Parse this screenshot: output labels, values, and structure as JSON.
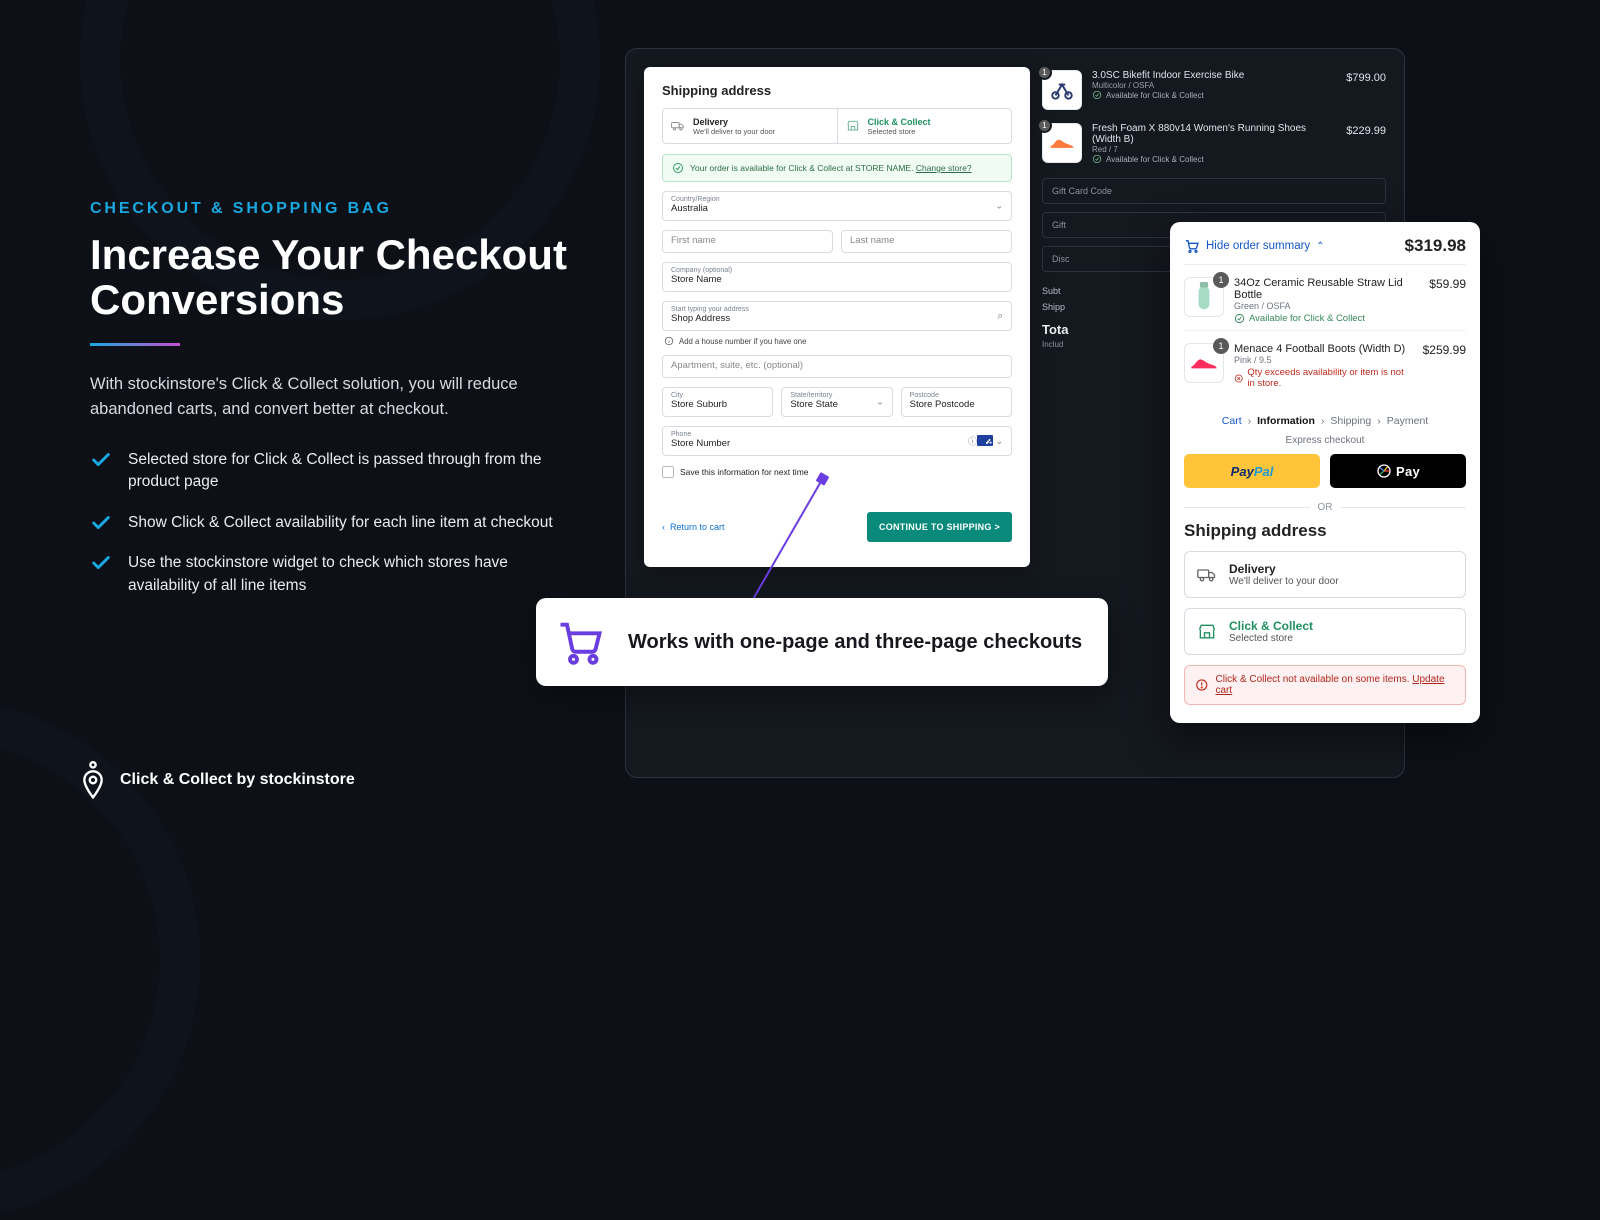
{
  "marketing": {
    "kicker": "CHECKOUT & SHOPPING BAG",
    "headline1": "Increase Your Checkout",
    "headline2": "Conversions",
    "lead": "With stockinstore's Click & Collect solution, you will reduce abandoned carts, and convert better at checkout.",
    "bullets": [
      "Selected store for Click & Collect is passed through from the product page",
      "Show Click & Collect availability for each line item at checkout",
      "Use the stockinstore widget to check which stores have availability of all line items"
    ],
    "footer": "Click & Collect by stockinstore"
  },
  "callout": "Works with one-page and three-page checkouts",
  "checkout": {
    "title": "Shipping address",
    "delivery": {
      "title": "Delivery",
      "sub": "We'll deliver to your door"
    },
    "cc": {
      "title": "Click & Collect",
      "sub": "Selected store"
    },
    "notice_a": "Your order is available for Click & Collect at STORE NAME.",
    "notice_link": "Change store?",
    "fields": {
      "country_label": "Country/Region",
      "country": "Australia",
      "first_name": "First name",
      "last_name": "Last name",
      "company_label": "Company (optional)",
      "company": "Store Name",
      "addr_label": "Start typing your address",
      "addr": "Shop Address",
      "hint": "Add a house number if you have one",
      "apt": "Apartment, suite, etc. (optional)",
      "city_label": "City",
      "city": "Store Suburb",
      "state_label": "State/territory",
      "state": "Store State",
      "post_label": "Postcode",
      "post": "Store Postcode",
      "phone_label": "Phone",
      "phone": "Store Number"
    },
    "save": "Save this information for next time",
    "back": "Return to cart",
    "cta": "CONTINUE TO SHIPPING >"
  },
  "order_summary": {
    "items": [
      {
        "qty": "1",
        "title": "3.0SC Bikefit Indoor Exercise Bike",
        "variant": "Multicolor / OSFA",
        "avail": "Available for Click & Collect",
        "price": "$799.00"
      },
      {
        "qty": "1",
        "title": "Fresh Foam X 880v14 Women's Running Shoes (Width B)",
        "variant": "Red / 7",
        "avail": "Available for Click & Collect",
        "price": "$229.99"
      }
    ],
    "gift_label": "Gift Card Code",
    "gift2": "Gift",
    "discount": "Disc",
    "subtotal_label": "Subt",
    "shipping_label": "Shipp",
    "total_label": "Tota",
    "includes": "Includ"
  },
  "mobile": {
    "hide": "Hide order summary",
    "total": "$319.98",
    "items": [
      {
        "qty": "1",
        "title": "34Oz Ceramic Reusable Straw Lid Bottle",
        "variant": "Green / OSFA",
        "avail": "Available for Click & Collect",
        "ok": true,
        "price": "$59.99"
      },
      {
        "qty": "1",
        "title": "Menace 4 Football Boots (Width D)",
        "variant": "Pink / 9.5",
        "avail": "Qty exceeds availability or item is not in store.",
        "ok": false,
        "price": "$259.99"
      }
    ],
    "crumbs": {
      "cart": "Cart",
      "info": "Information",
      "ship": "Shipping",
      "pay": "Payment"
    },
    "express": "Express checkout",
    "paypal_a": "Pay",
    "paypal_b": "Pal",
    "gpay": "Pay",
    "or": "OR",
    "title": "Shipping address",
    "delivery": {
      "title": "Delivery",
      "sub": "We'll deliver to your door"
    },
    "cc": {
      "title": "Click & Collect",
      "sub": "Selected store"
    },
    "alert_a": "Click & Collect not available on some items.",
    "alert_link": "Update cart"
  }
}
